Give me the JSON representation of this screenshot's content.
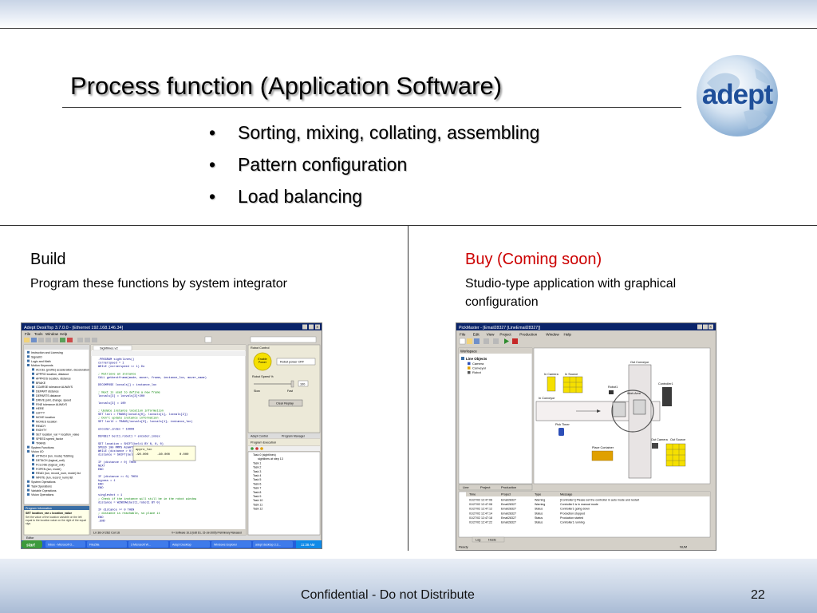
{
  "slide": {
    "title": "Process function (Application Software)",
    "bullets": [
      "Sorting, mixing, collating, assembling",
      "Pattern configuration",
      "Load balancing"
    ],
    "logo_text": "adept",
    "page_number": "22",
    "footer": "Confidential - Do not Distribute"
  },
  "build": {
    "title": "Build",
    "subtitle": "Program these functions by system integrator"
  },
  "buy": {
    "title": "Buy (Coming soon)",
    "subtitle": "Studio-type application with graphical configuration"
  },
  "colors": {
    "buy_title": "#cc0000",
    "titlebar": "#0a246a",
    "taskbar": "#245edb",
    "start_button": "#3c9a3c",
    "accent_yellow": "#f5e000",
    "conveyor": "#dcd4b0",
    "logo_blue": "#1f4f9a"
  },
  "build_screenshot": {
    "window_title": "Adept DeskTop 3.7.0.0 - [Ethernet 192.168.146.34]",
    "menu": [
      "File",
      "Tools",
      "Window",
      "Help"
    ],
    "tree_items": [
      "Instruction and Licensing",
      "SignalIO",
      "Logic and Math",
      "Motion Keywords",
      "ACCEL (profile) acceleration, deceleration",
      "APPRO location, distance",
      "APPROS location, distance",
      "BRAKE",
      "COARSE tolerance ALWAYS",
      "DEPART distance",
      "DEPARTS distance",
      "DRIVE joint, change, speed",
      "FINE tolerance ALWAYS",
      "HERE",
      "LEFTY",
      "MOVE location",
      "MOVES location",
      "READY",
      "RIGHTY",
      "SET location_var = location_value",
      "SPEED speed_factor",
      "TRANS",
      "System Functions",
      "Vision I/O",
      "ATTACH (lun, mode) ToString",
      "DETACH (logical_unit)",
      "FCLOSE (logical_unit)",
      "FOPEN (lun, mode)",
      "READ (lun, record_num, mode) list",
      "WRITE (lun, record_num) list",
      "System Operations",
      "Task Operations",
      "Variable Operations",
      "Vision Operations"
    ],
    "properties_header": "Program Information",
    "properties_text": "SET location_var = location_value",
    "properties_note": "Set the value of the location variable on the left equal to the location value on the right of the equal sign.",
    "editor_tab": "Sightlines.v2",
    "code_lines": [
      ".PROGRAM sightlines()",
      "  cornerspeed = 1",
      "  WHILE (cornerspeed <> 1) Do",
      "",
      "  ; Retrieve an instance",
      "  CALL getbestframe(mode, mover, frame, instance_loc, mover_name)",
      "",
      "  DECOMPOSE locvals[] = instance_loc",
      "",
      "  ; Next is used to define a new frame",
      "  locvals[3] = locvals[3]+200",
      "",
      "  locvals[3] = 100",
      "",
      "  ; Update instance location information",
      "  SET locl = TRANS(locvals[0], locvals[1], locvals[2])",
      "  ; Don't update instance information",
      "  SET locl2 = TRANS(locvals[0], locvals[1], instance_loc)",
      "",
      "  encoder_index = 10000",
      "",
      "  DEFBELT belt1.robot1 = encoder_index",
      "",
      "  SET location = SHIFT(belt1 BY 0, 0, 0)",
      "  SPEED 100 MMPS ALWAYS",
      "  WHILE (distance > 0) Do",
      "    distance = SHIFT(belt1.robot1 BY 0)",
      "",
      "    IF (distance > 0) THEN",
      "      NEXT",
      "    END",
      "",
      "    IF (distance >= 0) THEN",
      "      bypass = 1",
      "    END",
      "  END",
      "",
      "  singleshot = 1",
      "  ; Check if the instance will still be in the robot window",
      "  distance = WINDOW(belt1.robot1 BY 0)",
      "",
      "  IF distance >= 0 THEN",
      "    ; distance is reachable, so place it",
      "  END",
      ".END"
    ],
    "watch_popup": [
      "appro_loc",
      "-90.000",
      "-90.000",
      "0.000"
    ],
    "status_left": "Ln 38 of 262  Col 16",
    "status_right": "V+ Software 16.2 (Edit D1, 15-Jul-2005) Preliminary Released",
    "controls_header": "Robot Control",
    "controls_button": "Enable Power",
    "power_label": "Robot power OFF",
    "speed_label": "Robot Speed %",
    "speed_value": "100",
    "slider_min": "Slow",
    "slider_max": "Fast",
    "replay_button": "Clear Replay",
    "bottom_tabs": [
      "Adept Control",
      "Program Manager"
    ],
    "task_panel_header": "Program Execution",
    "tasks": [
      "Task 0 (sightlines)",
      "sightlines at step 13",
      "Task 1",
      "Task 2",
      "Task 3",
      "Task 4",
      "Task 5",
      "Task 6",
      "Task 7",
      "Task 8",
      "Task 9",
      "Task 10",
      "Task 11",
      "Task 12"
    ],
    "bottom_panel_title": "Editor",
    "taskbar_start": "start",
    "taskbar_items": [
      "Inbox - Microsoft O...",
      "FileZilla",
      "3 Microsoft W...",
      "Adept Desktop",
      "Windows Explorer",
      "adept desktop 3.3..."
    ],
    "taskbar_clock": "11:38 AM"
  },
  "buy_screenshot": {
    "window_title": "PickMaster - [Email28327 [LineEmail28327]]",
    "menu": [
      "File",
      "Edit",
      "View",
      "Project",
      "Production",
      "Window",
      "Help"
    ],
    "workspace_label": "Workspace",
    "tree_root": "Line Objects",
    "tree_items": [
      "Camera",
      "Conveyor",
      "Robot"
    ],
    "canvas_labels": {
      "in_camera": "In Camera",
      "in_source": "In Source",
      "out_conveyor": "Out Conveyor",
      "robot": "Robot1",
      "work_area": "Work Area",
      "in_conveyor": "In Conveyor",
      "pick_timer": "Pick Timer",
      "place_container": "Place Container",
      "controller": "Controller1",
      "out_camera": "Out Camera",
      "out_source": "Out Source"
    },
    "tabs": [
      "Line",
      "Project",
      "Production"
    ],
    "log_columns": [
      "Time",
      "Project",
      "Type",
      "Message"
    ],
    "log_rows": [
      [
        "01/27/02 12:47:06",
        "Email28327",
        "Warning",
        "[Controller1] Please set the controller in auto mode and restart"
      ],
      [
        "01/27/02 12:47:08",
        "Email28327",
        "Warning",
        "Controller1 is in manual mode"
      ],
      [
        "01/27/02 12:47:12",
        "Email28327",
        "Status",
        "Controller1 going down"
      ],
      [
        "01/27/02 12:47:14",
        "Email28327",
        "Status",
        "Production stopped"
      ],
      [
        "01/27/02 12:47:18",
        "Email28327",
        "Status",
        "Production started"
      ],
      [
        "01/27/02 12:47:22",
        "Email28327",
        "Status",
        "Controller1 running"
      ]
    ],
    "log_tabs": [
      "Log",
      "Hosts"
    ],
    "status_left": "Ready",
    "status_right": "NUM"
  }
}
